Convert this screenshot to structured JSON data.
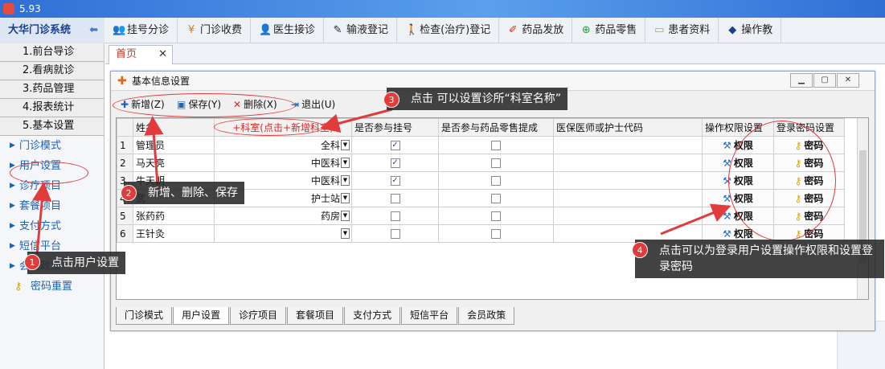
{
  "window": {
    "title": "5.93"
  },
  "header": {
    "brand": "大华门诊系统",
    "toolbar": [
      {
        "icon": "users-icon",
        "label": "挂号分诊"
      },
      {
        "icon": "yen-icon",
        "label": "门诊收费"
      },
      {
        "icon": "doctor-icon",
        "label": "医生接诊"
      },
      {
        "icon": "syringe-icon",
        "label": "输液登记"
      },
      {
        "icon": "walk-icon",
        "label": "检查(治疗)登记"
      },
      {
        "icon": "pill-icon",
        "label": "药品发放"
      },
      {
        "icon": "plus-circle-icon",
        "label": "药品零售"
      },
      {
        "icon": "folder-icon",
        "label": "患者资料"
      },
      {
        "icon": "book-icon",
        "label": "操作教"
      }
    ]
  },
  "sidebar": {
    "groups": [
      "1.前台导诊",
      "2.看病就诊",
      "3.药品管理",
      "4.报表统计",
      "5.基本设置"
    ],
    "items": [
      "门诊模式",
      "用户设置",
      "诊疗项目",
      "套餐项目",
      "支付方式",
      "短信平台",
      "会员政策",
      "密码重置"
    ]
  },
  "tabs": {
    "home": "首页",
    "close": "✕"
  },
  "dialog": {
    "title": "基本信息设置",
    "buttons": {
      "add": "新增(Z)",
      "save": "保存(Y)",
      "delete": "删除(X)",
      "exit": "退出(U)"
    },
    "columns": [
      "姓名",
      "+科室(点击+新增科室)",
      "是否参与挂号",
      "是否参与药品零售提成",
      "医保医师或护士代码",
      "操作权限设置",
      "登录密码设置"
    ],
    "rows": [
      {
        "no": "1",
        "name": "管理员",
        "dept": "全科",
        "register": true,
        "retail": false,
        "code": "",
        "perm": "权限",
        "pwd": "密码"
      },
      {
        "no": "2",
        "name": "马天亮",
        "dept": "中医科",
        "register": true,
        "retail": false,
        "code": "",
        "perm": "权限",
        "pwd": "密码"
      },
      {
        "no": "3",
        "name": "牛天明",
        "dept": "中医科",
        "register": true,
        "retail": false,
        "code": "",
        "perm": "权限",
        "pwd": "密码"
      },
      {
        "no": "4",
        "name": "武",
        "dept": "护士站",
        "register": false,
        "retail": false,
        "code": "",
        "perm": "权限",
        "pwd": "密码"
      },
      {
        "no": "5",
        "name": "张药药",
        "dept": "药房",
        "register": false,
        "retail": false,
        "code": "",
        "perm": "权限",
        "pwd": "密码"
      },
      {
        "no": "6",
        "name": "王针灸",
        "dept": "",
        "register": false,
        "retail": false,
        "code": "",
        "perm": "权限",
        "pwd": "密码"
      }
    ],
    "bottom_tabs": [
      "门诊模式",
      "用户设置",
      "诊疗项目",
      "套餐项目",
      "支付方式",
      "短信平台",
      "会员政策"
    ]
  },
  "annotations": [
    {
      "num": "1",
      "text": "点击用户设置"
    },
    {
      "num": "2",
      "text": "新增、删除、保存"
    },
    {
      "num": "3",
      "text": "点击 可以设置诊所“科室名称”"
    },
    {
      "num": "4",
      "text": "点击可以为登录用户设置操作权限和设置登录密码"
    }
  ],
  "colors": {
    "accent": "#1e64b4",
    "annotation": "#e23b3b"
  }
}
